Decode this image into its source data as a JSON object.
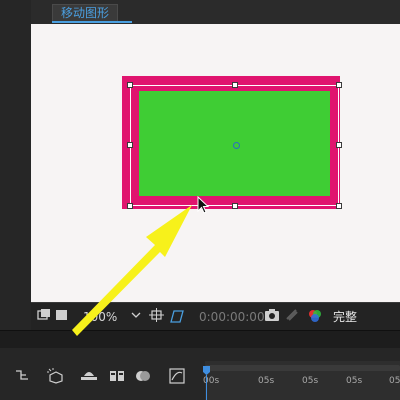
{
  "composition_tab": {
    "label": "移动图形"
  },
  "viewer_toolbar": {
    "zoom": "100%",
    "timecode": "0:00:00:00",
    "resolution": "完整"
  },
  "timeline": {
    "ruler_labels": [
      "00s",
      "05s",
      "05s",
      "05s",
      "05"
    ]
  },
  "colors": {
    "shape_stroke": "#e0146e",
    "shape_fill": "#3fcd34",
    "annotation_arrow": "#f7f11b",
    "accent": "#4a9fe0"
  },
  "icons": {
    "left_strip": [
      "left-panel-icon"
    ],
    "viewer_toolbar": [
      "always-preview-icon",
      "mask-view-icon",
      "region-of-interest-icon",
      "transparency-grid-icon",
      "snapshot-icon",
      "show-snapshot-icon",
      "channel-icon"
    ],
    "timeline": [
      "parent-link-icon",
      "draft-3d-icon",
      "shy-layers-icon",
      "frame-blending-icon",
      "motion-blur-icon",
      "graph-editor-icon"
    ]
  }
}
